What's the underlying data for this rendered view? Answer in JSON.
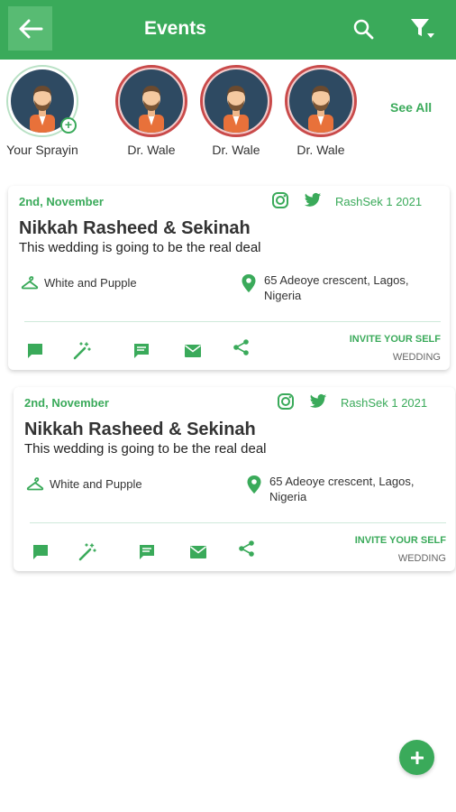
{
  "header": {
    "title": "Events",
    "back_icon": "arrow-left-icon",
    "search_icon": "search-icon",
    "filter_icon": "filter-icon"
  },
  "stories": {
    "items": [
      {
        "label": "Your Sprayin",
        "ring": "own",
        "badge": "+"
      },
      {
        "label": "Dr. Wale",
        "ring": "active"
      },
      {
        "label": "Dr. Wale",
        "ring": "active"
      },
      {
        "label": "Dr. Wale",
        "ring": "active"
      }
    ],
    "see_all": "See All"
  },
  "events": [
    {
      "date": "2nd, November",
      "handle": "RashSek 1 2021",
      "title": "Nikkah Rasheed & Sekinah",
      "description": "This wedding is going to be the real deal",
      "dress_code": "White and Pupple",
      "address": "65 Adeoye crescent, Lagos, Nigeria",
      "invite_label": "INVITE YOUR SELF",
      "category": "WEDDING"
    },
    {
      "date": "2nd, November",
      "handle": "RashSek 1 2021",
      "title": "Nikkah Rasheed & Sekinah",
      "description": "This wedding is going to be the real deal",
      "dress_code": "White and Pupple",
      "address": "65 Adeoye crescent, Lagos, Nigeria",
      "invite_label": "INVITE YOUR SELF",
      "category": "WEDDING"
    }
  ],
  "fab": {
    "label": "+"
  },
  "colors": {
    "primary": "#3aaa5a",
    "story_ring": "#c94a4a",
    "avatar_bg": "#2e4a62"
  }
}
